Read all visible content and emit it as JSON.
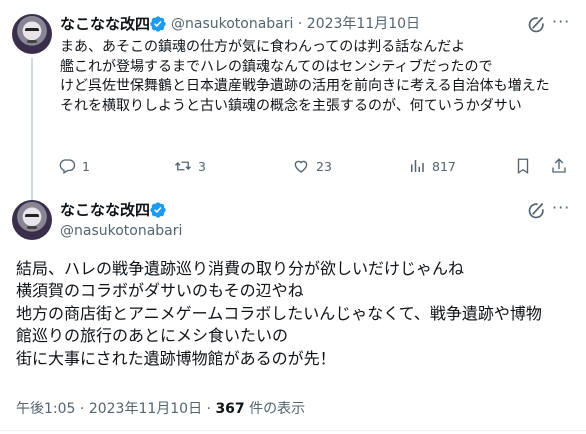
{
  "tweet1": {
    "display_name": "なこなな改四",
    "handle": "@nasukotonabari",
    "separator": "·",
    "date": "2023年11月10日",
    "lines": [
      "まあ、あそこの鎮魂の仕方が気に食わんってのは判る話なんだよ",
      "艦これが登場するまでハレの鎮魂なんてのはセンシティブだったので",
      "けど呉佐世保舞鶴と日本遺産戦争遺跡の活用を前向きに考える自治体も増えた",
      "それを横取りしようと古い鎮魂の概念を主張するのが、何ていうかダサい"
    ],
    "replies": "1",
    "reposts": "3",
    "likes": "23",
    "views": "817"
  },
  "tweet2": {
    "display_name": "なこなな改四",
    "handle": "@nasukotonabari",
    "lines": [
      "結局、ハレの戦争遺跡巡り消費の取り分が欲しいだけじゃんね",
      "横須賀のコラボがダサいのもその辺やね",
      "地方の商店街とアニメゲームコラボしたいんじゃなくて、戦争遺跡や博物",
      "館巡りの旅行のあとにメシ食いたいの",
      "街に大事にされた遺跡博物館があるのが先！"
    ],
    "time": "午後1:05",
    "separator": "·",
    "date": "2023年11月10日",
    "views_count": "367",
    "views_label": "件の表示"
  },
  "icons": {
    "verified": "verified-badge-icon",
    "grok": "grok-icon",
    "more": "more-icon",
    "reply": "reply-icon",
    "repost": "repost-icon",
    "like": "heart-icon",
    "views": "views-icon"
  },
  "colors": {
    "verified": "#1d9bf0",
    "muted": "#536471",
    "text": "#0f1419"
  }
}
